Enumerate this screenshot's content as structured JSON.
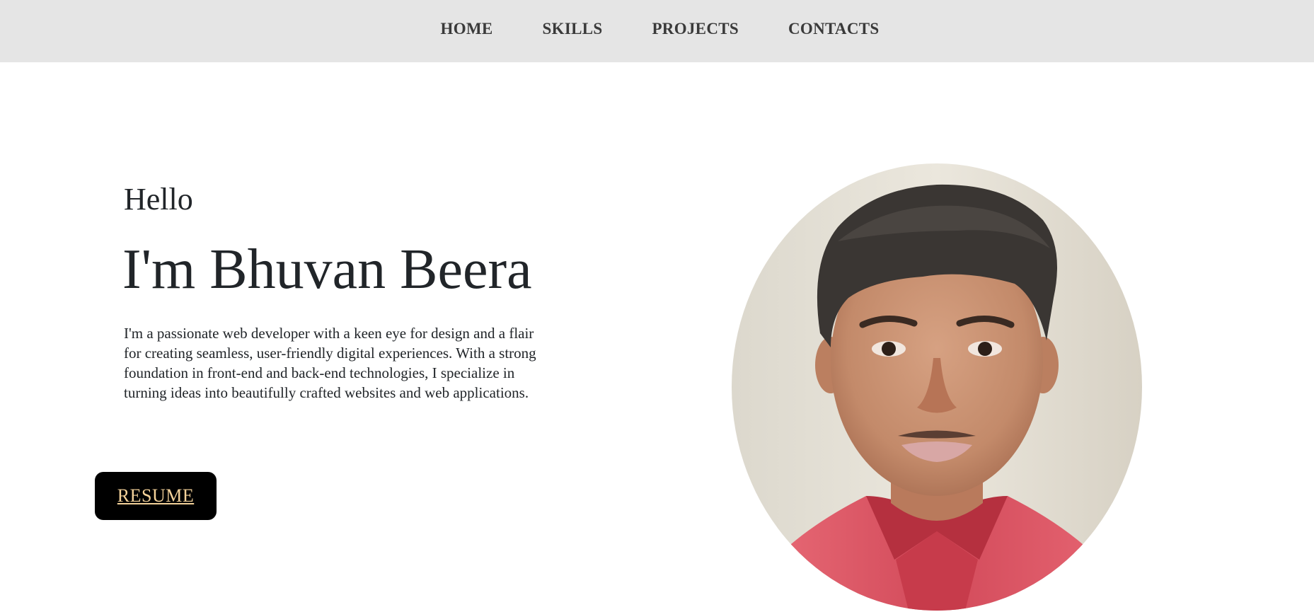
{
  "nav": {
    "items": [
      {
        "label": "HOME"
      },
      {
        "label": "SKILLS"
      },
      {
        "label": "PROJECTS"
      },
      {
        "label": "CONTACTS"
      }
    ]
  },
  "hero": {
    "greeting": "Hello",
    "name": "I'm Bhuvan Beera",
    "bio": "I'm a passionate web developer with a keen eye for design and a flair for creating seamless, user-friendly digital experiences. With a strong foundation in front-end and back-end technologies, I specialize in turning ideas into beautifully crafted websites and web applications.",
    "resume_label": "RESUME"
  },
  "colors": {
    "navbar_bg": "#e5e5e5",
    "button_bg": "#000000",
    "button_text": "#f3d199",
    "text": "#212529"
  },
  "images": {
    "portrait": "profile-photo"
  }
}
